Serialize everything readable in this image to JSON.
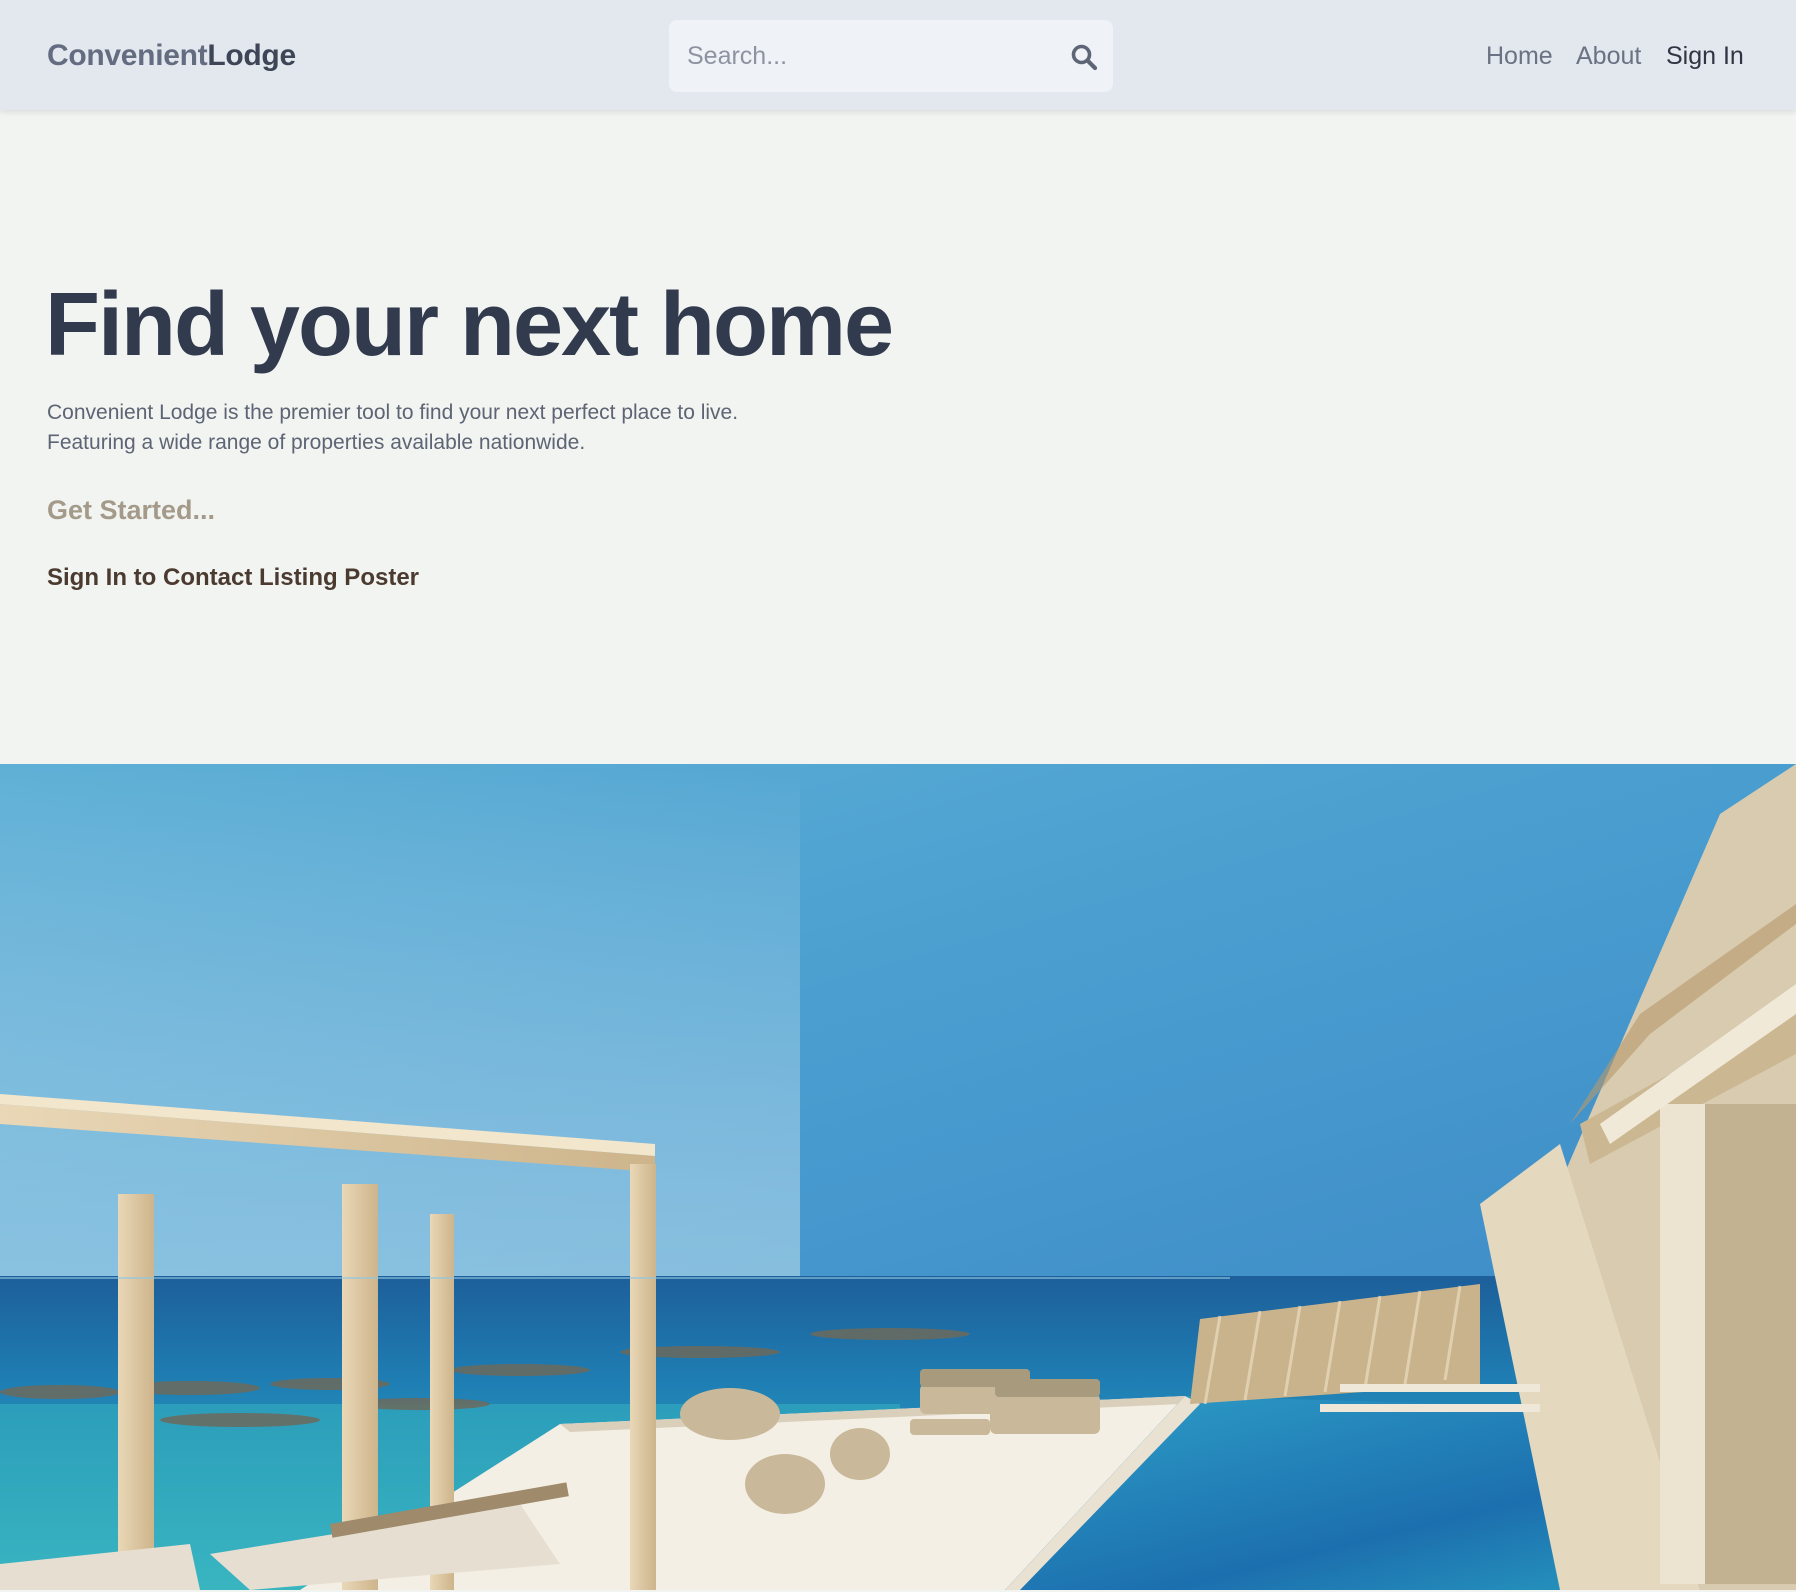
{
  "header": {
    "logo_part1": "Convenient",
    "logo_part2": "Lodge",
    "search_placeholder": "Search...",
    "nav": {
      "home": "Home",
      "about": "About",
      "sign_in": "Sign In"
    }
  },
  "hero": {
    "title": "Find your next home",
    "description_line1": "Convenient Lodge is the premier tool to find your next perfect place to live.",
    "description_line2": "Featuring a wide range of properties available nationwide.",
    "get_started": "Get Started...",
    "contact_link": "Sign In to Contact Listing Poster"
  },
  "colors": {
    "header_bg": "#e3e7ee",
    "page_bg": "#f2f4f2",
    "title": "#323a4e",
    "get_started": "#a49a89",
    "contact_link": "#4b3a30"
  },
  "icons": {
    "search": "search-icon"
  },
  "image": {
    "subject": "beachfront-resort-pool-photo"
  }
}
